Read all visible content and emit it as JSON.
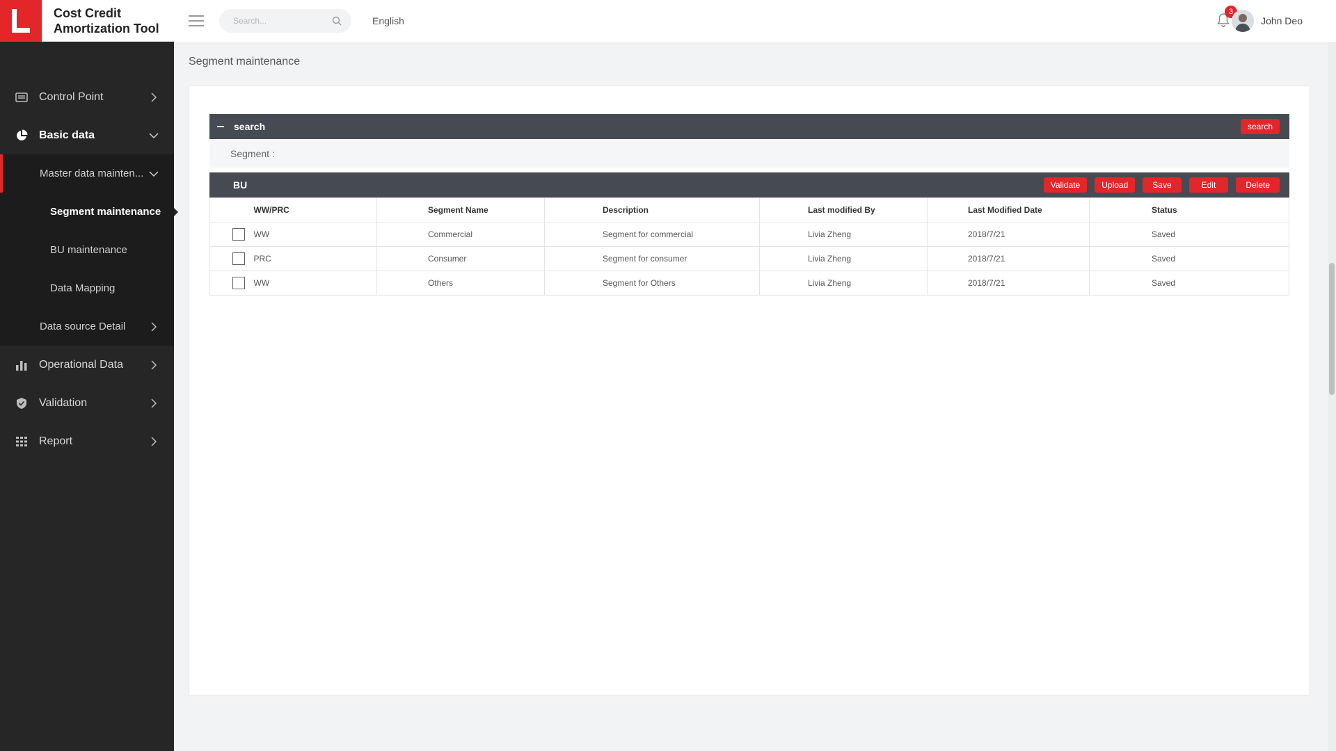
{
  "app": {
    "title": "Cost Credit Amortization Tool",
    "logo_letter": "L"
  },
  "header": {
    "search_placeholder": "Search...",
    "language": "English",
    "notification_count": "3",
    "user_name": "John Deo"
  },
  "sidebar": {
    "control_point": "Control Point",
    "basic_data": "Basic data",
    "master_data": "Master data mainten...",
    "segment_maintenance": "Segment maintenance",
    "bu_maintenance": "BU maintenance",
    "data_mapping": "Data Mapping",
    "data_source_detail": "Data source Detail",
    "operational_data": "Operational Data",
    "validation": "Validation",
    "report": "Report"
  },
  "page": {
    "title": "Segment maintenance"
  },
  "search_section": {
    "title": "search",
    "button": "search",
    "segment_label": "Segment :"
  },
  "bu_section": {
    "title": "BU",
    "buttons": {
      "validate": "Validate",
      "upload": "Upload",
      "save": "Save",
      "edit": "Edit",
      "delete": "Delete"
    }
  },
  "table": {
    "headers": [
      "WW/PRC",
      "Segment Name",
      "Description",
      "Last modified By",
      "Last Modified Date",
      "Status"
    ],
    "rows": [
      [
        "WW",
        "Commercial",
        "Segment for commercial",
        "Livia Zheng",
        "2018/7/21",
        "Saved"
      ],
      [
        "PRC",
        "Consumer",
        "Segment for consumer",
        "Livia Zheng",
        "2018/7/21",
        "Saved"
      ],
      [
        "WW",
        "Others",
        "Segment for Others",
        "Livia Zheng",
        "2018/7/21",
        "Saved"
      ]
    ]
  },
  "colors": {
    "accent": "#e3262a",
    "sidebar": "#262626",
    "bar": "#464a53"
  }
}
